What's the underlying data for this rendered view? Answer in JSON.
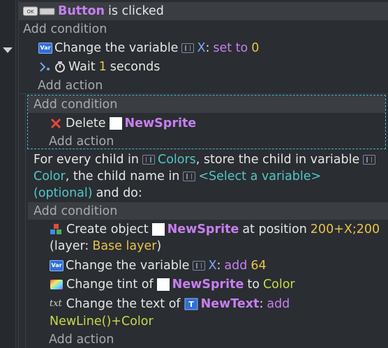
{
  "event1": {
    "condition": {
      "object": "Button",
      "text": "is clicked"
    },
    "add_condition": "Add condition",
    "actions": [
      {
        "prefix": "Change the variable",
        "var": "X",
        "colon": ":",
        "op": "set to",
        "value": "0"
      },
      {
        "prefix": "Wait",
        "value": "1",
        "suffix": "seconds"
      }
    ],
    "add_action": "Add action"
  },
  "event2": {
    "add_condition": "Add condition",
    "action": {
      "prefix": "Delete",
      "object": "NewSprite"
    },
    "add_action": "Add action"
  },
  "event3": {
    "line1": {
      "a": "For every child in",
      "var1": "Colors",
      "b": ", store the child in variable"
    },
    "line2": {
      "var2": "Color",
      "c": ", the child name in",
      "select": "<Select a variable>"
    },
    "line3": {
      "optional": "(optional)",
      "d": "and do:"
    },
    "add_condition": "Add condition",
    "actions": {
      "create": {
        "prefix": "Create object",
        "object": "NewSprite",
        "mid": "at position",
        "pos": "200+X;200",
        "layer_pre": "(layer:",
        "layer": "Base layer",
        "layer_post": ")"
      },
      "change_var": {
        "prefix": "Change the variable",
        "var": "X",
        "colon": ":",
        "op": "add",
        "value": "64"
      },
      "tint": {
        "prefix": "Change tint of",
        "object": "NewSprite",
        "mid": "to",
        "value": "Color"
      },
      "text": {
        "prefix": "Change the text of",
        "object": "NewText",
        "colon": ":",
        "op": "add",
        "value": "NewLine()+Color"
      }
    },
    "add_action": "Add action"
  },
  "colors": {
    "background": "#2a2d31",
    "condition_bar": "#3a3d42",
    "object": "#c77ff0",
    "number": "#e8c34a",
    "variable": "#7fa8ff",
    "teal": "#52c7c7",
    "selection_border": "#4fb0d8"
  },
  "icons": [
    "button-object-icon",
    "variable-action-icon",
    "wait-icon",
    "timer-icon",
    "delete-icon",
    "create-object-icon",
    "tint-icon",
    "text-icon",
    "text-object-icon",
    "variable-icon",
    "collapse-arrow-icon"
  ]
}
